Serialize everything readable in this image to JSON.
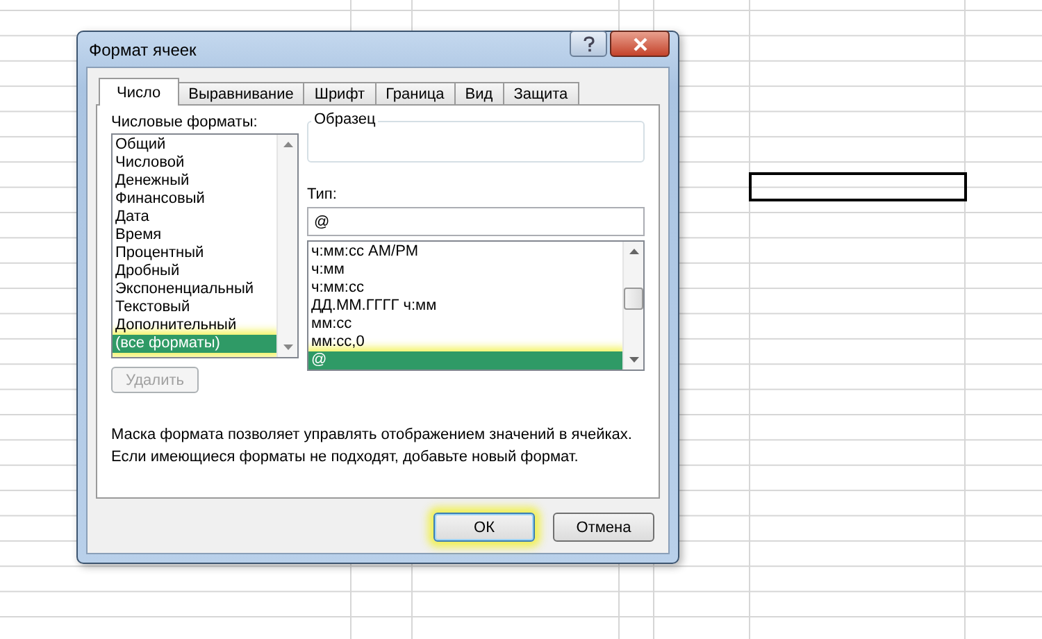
{
  "window": {
    "title": "Формат ячеек"
  },
  "tabs": [
    {
      "label": "Число",
      "selected": true
    },
    {
      "label": "Выравнивание",
      "selected": false
    },
    {
      "label": "Шрифт",
      "selected": false
    },
    {
      "label": "Граница",
      "selected": false
    },
    {
      "label": "Вид",
      "selected": false
    },
    {
      "label": "Защита",
      "selected": false
    }
  ],
  "categories": {
    "label": "Числовые форматы:",
    "items": [
      {
        "label": "Общий",
        "selected": false,
        "highlighted": false
      },
      {
        "label": "Числовой",
        "selected": false,
        "highlighted": false
      },
      {
        "label": "Денежный",
        "selected": false,
        "highlighted": false
      },
      {
        "label": "Финансовый",
        "selected": false,
        "highlighted": false
      },
      {
        "label": "Дата",
        "selected": false,
        "highlighted": false
      },
      {
        "label": "Время",
        "selected": false,
        "highlighted": false
      },
      {
        "label": "Процентный",
        "selected": false,
        "highlighted": false
      },
      {
        "label": "Дробный",
        "selected": false,
        "highlighted": false
      },
      {
        "label": "Экспоненциальный",
        "selected": false,
        "highlighted": false
      },
      {
        "label": "Текстовый",
        "selected": false,
        "highlighted": false
      },
      {
        "label": "Дополнительный",
        "selected": false,
        "highlighted": false
      },
      {
        "label": "(все форматы)",
        "selected": true,
        "highlighted": true
      }
    ]
  },
  "sample": {
    "label": "Образец"
  },
  "type": {
    "label": "Тип:",
    "value": "@",
    "items": [
      {
        "label": "ч:мм:сс AM/PM",
        "selected": false,
        "highlighted": false
      },
      {
        "label": "ч:мм",
        "selected": false,
        "highlighted": false
      },
      {
        "label": "ч:мм:сс",
        "selected": false,
        "highlighted": false
      },
      {
        "label": "ДД.ММ.ГГГГ ч:мм",
        "selected": false,
        "highlighted": false
      },
      {
        "label": "мм:сс",
        "selected": false,
        "highlighted": false
      },
      {
        "label": "мм:сс,0",
        "selected": false,
        "highlighted": false
      },
      {
        "label": "@",
        "selected": true,
        "highlighted": true
      }
    ]
  },
  "delete_button": {
    "label": "Удалить",
    "disabled": true
  },
  "description": "Маска формата позволяет управлять отображением значений в ячейках. Если имеющиеся форматы не подходят, добавьте новый формат.",
  "buttons": [
    {
      "label": "ОК",
      "highlighted": true
    },
    {
      "label": "Отмена",
      "highlighted": false
    }
  ]
}
